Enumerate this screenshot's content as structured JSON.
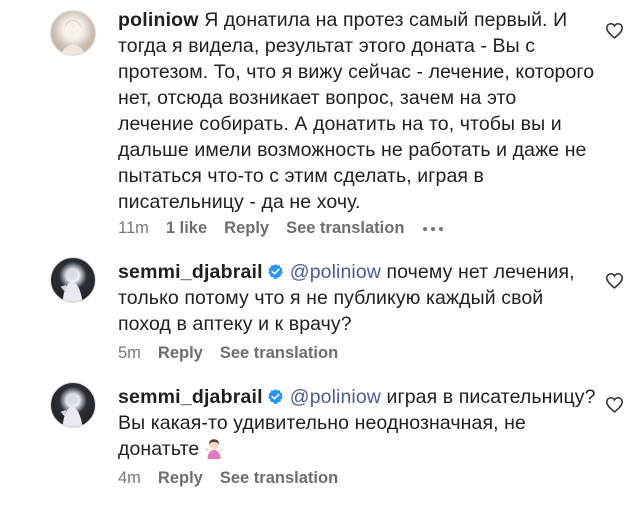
{
  "comments": [
    {
      "username": "poliniow",
      "mention": "",
      "text": "Я донатила на протез самый первый. И тогда я видела, результат этого доната - Вы с протезом. То, что я вижу сейчас - лечение, которого нет, отсюда возникает вопрос, зачем на это лечение собирать. А донатить на то, чтобы вы и дальше имели возможность не работать и даже не пытаться что-то с этим сделать, играя в писательницу - да не хочу.",
      "time": "11m",
      "likes": "1 like",
      "reply": "Reply",
      "see_translation": "See translation"
    },
    {
      "username": "semmi_djabrail",
      "mention": "@poliniow",
      "text": "почему нет лечения, только потому что я не публикую каждый свой поход в аптеку и к врачу?",
      "time": "5m",
      "reply": "Reply",
      "see_translation": "See translation"
    },
    {
      "username": "semmi_djabrail",
      "mention": "@poliniow",
      "text": "играя в писательницу? Вы какая-то удивительно неоднозначная, не донатьте",
      "time": "4m",
      "reply": "Reply",
      "see_translation": "See translation"
    }
  ],
  "icons": {
    "verified": "verified-badge-icon",
    "like": "heart-icon",
    "more": "more-options-icon",
    "emoji": "woman-shrugging-emoji"
  },
  "colors": {
    "mention": "#4a5d99",
    "verified": "#2b95f6",
    "meta": "#777777"
  }
}
